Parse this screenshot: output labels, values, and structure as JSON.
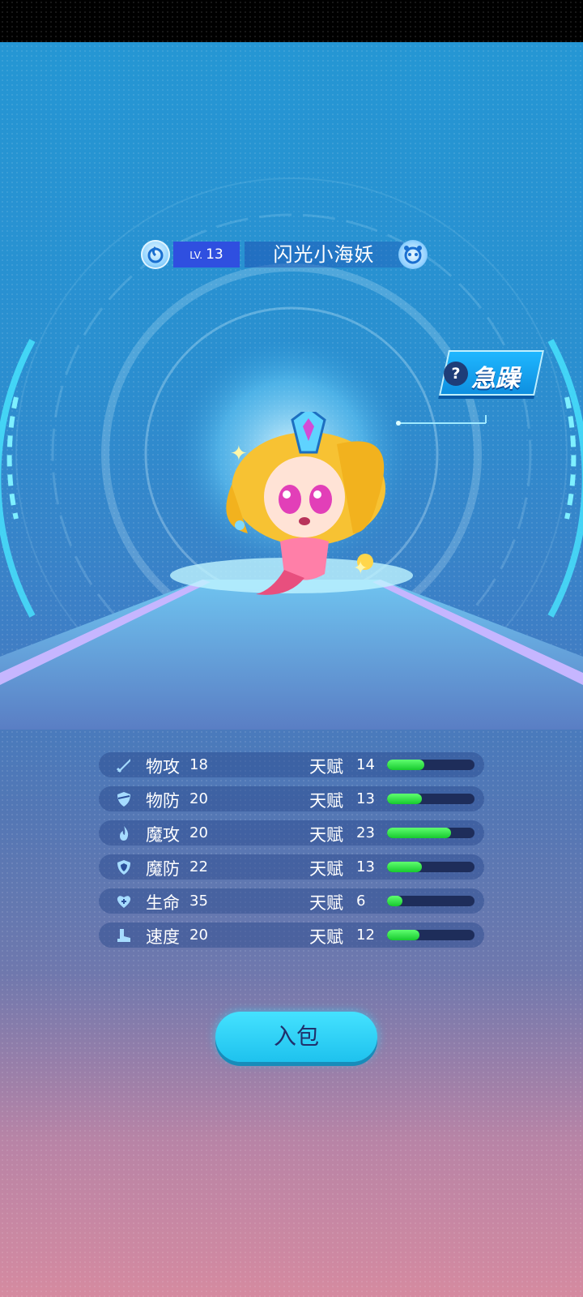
{
  "header": {
    "level_prefix": "LV.",
    "level": "13",
    "pet_name": "闪光小海妖",
    "element_icon": "water-drop-icon",
    "pet_icon": "pet-face-icon"
  },
  "temper": {
    "help_glyph": "?",
    "label": "急躁"
  },
  "stats": [
    {
      "icon": "sword-icon",
      "label": "物攻",
      "value": "18",
      "talent_label": "天赋",
      "talent": "14",
      "talent_fraction": 0.43
    },
    {
      "icon": "shield-icon",
      "label": "物防",
      "value": "20",
      "talent_label": "天赋",
      "talent": "13",
      "talent_fraction": 0.4
    },
    {
      "icon": "flame-icon",
      "label": "魔攻",
      "value": "20",
      "talent_label": "天赋",
      "talent": "23",
      "talent_fraction": 0.73
    },
    {
      "icon": "magic-shield-icon",
      "label": "魔防",
      "value": "22",
      "talent_label": "天赋",
      "talent": "13",
      "talent_fraction": 0.4
    },
    {
      "icon": "heart-plus-icon",
      "label": "生命",
      "value": "35",
      "talent_label": "天赋",
      "talent": "6",
      "talent_fraction": 0.18
    },
    {
      "icon": "boot-icon",
      "label": "速度",
      "value": "20",
      "talent_label": "天赋",
      "talent": "12",
      "talent_fraction": 0.37
    }
  ],
  "action": {
    "bag_label": "入包"
  },
  "colors": {
    "accent": "#1ec2ee",
    "level_bg": "#2f4fe0",
    "bar_fill": "#17c92e"
  }
}
